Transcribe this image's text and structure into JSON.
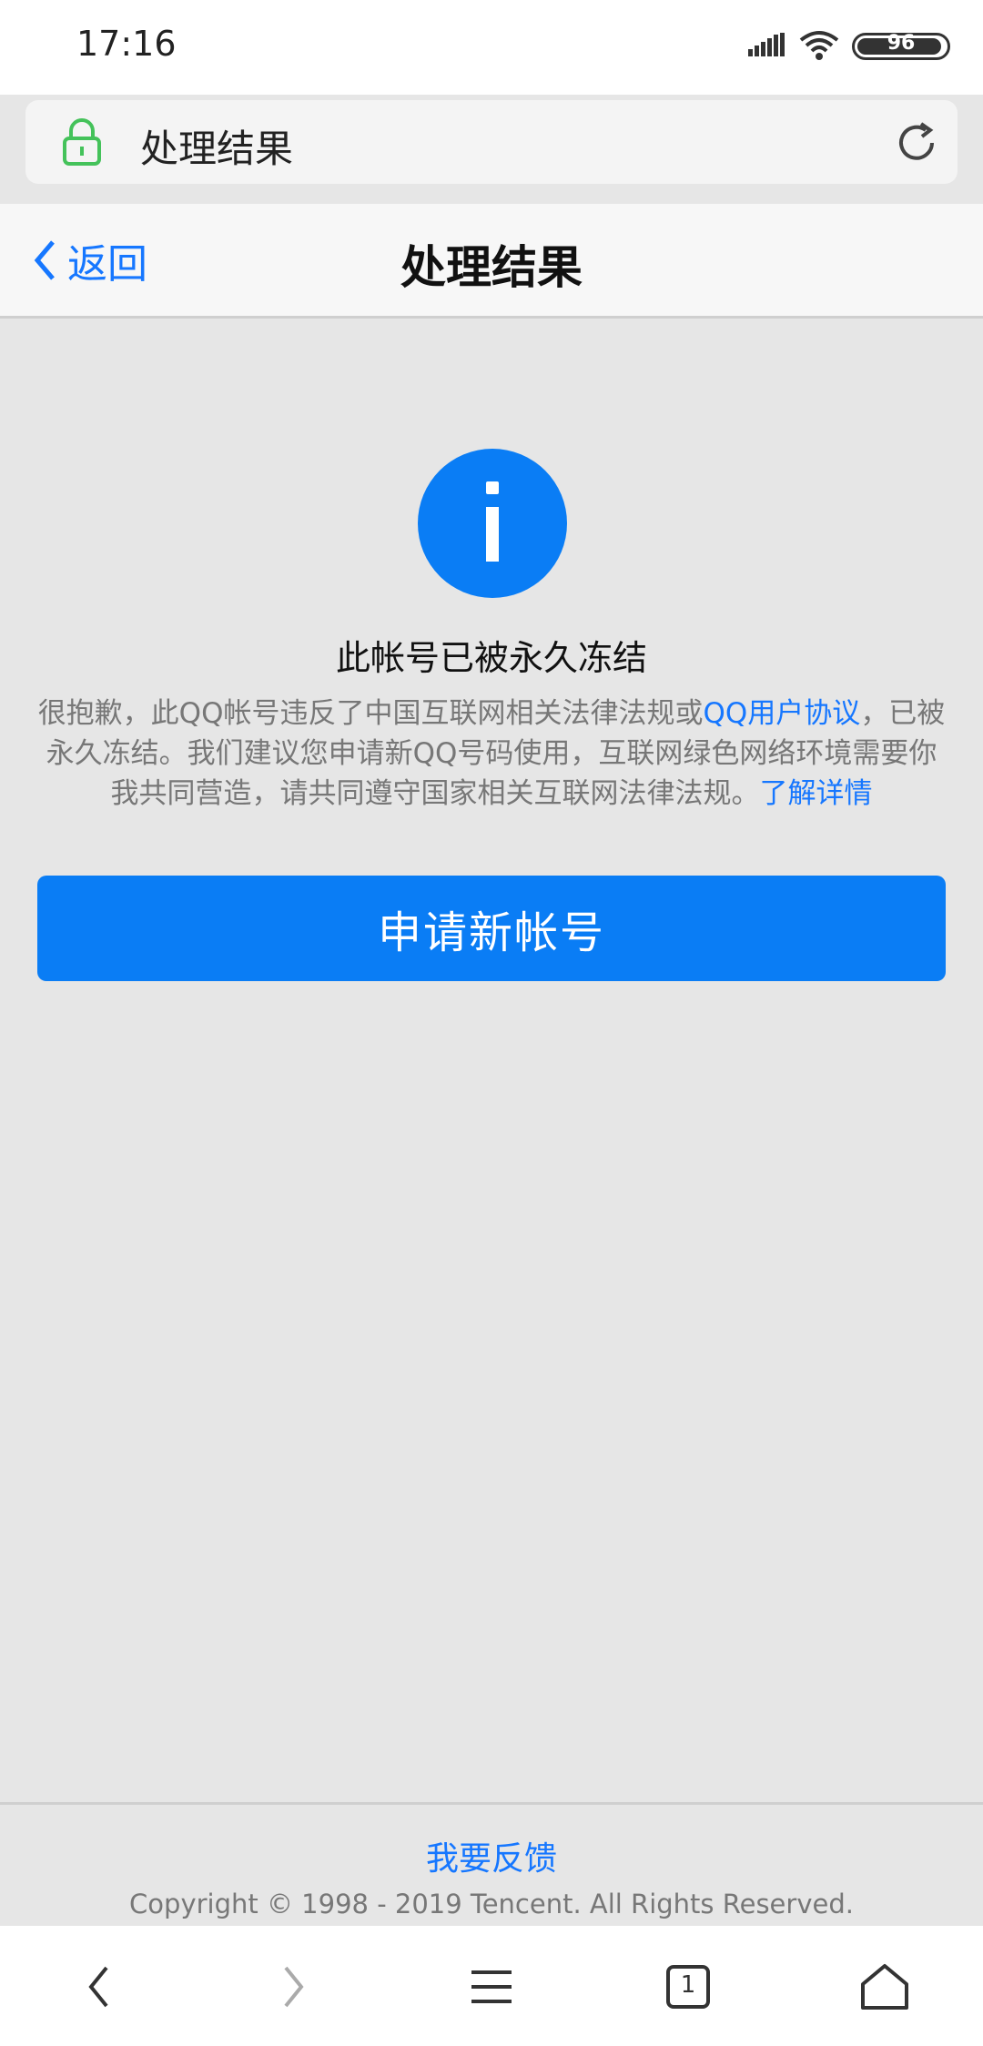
{
  "status_bar": {
    "time": "17:16",
    "battery": "96",
    "battery_level": 0.96,
    "icons": [
      "signal-icon",
      "wifi-icon",
      "battery-icon"
    ]
  },
  "address_bar": {
    "title": "处理结果",
    "icons": [
      "lock-icon",
      "reload-icon"
    ],
    "lock_color": "#44c25a"
  },
  "nav": {
    "back_label": "返回",
    "title": "处理结果"
  },
  "message": {
    "icon": "info-icon",
    "title": "此帐号已被永久冻结",
    "body_part1": "很抱歉，此QQ帐号违反了中国互联网相关法律法规或",
    "link1": "QQ用户协议",
    "body_part2": "，已被永久冻结。我们建议您申请新QQ号码使用，互联网绿色网络环境需要你我共同营造，请共同遵守国家相关互联网法律法规。",
    "link2": "了解详情"
  },
  "primary_button": {
    "label": "申请新帐号"
  },
  "footer": {
    "feedback": "我要反馈",
    "copyright": "Copyright © 1998 - 2019 Tencent. All Rights Reserved."
  },
  "bottom_bar": {
    "tab_count": "1",
    "icons": [
      "back-arrow-icon",
      "forward-arrow-icon",
      "menu-icon",
      "tabs-icon",
      "home-icon"
    ]
  },
  "colors": {
    "accent": "#1677ff",
    "button": "#0a7df5",
    "background": "#e6e6e6"
  }
}
